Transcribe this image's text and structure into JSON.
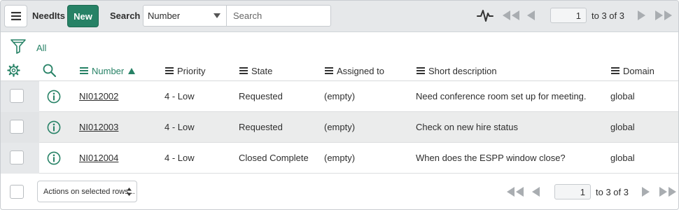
{
  "header": {
    "title": "NeedIts",
    "new_label": "New",
    "search_label": "Search",
    "search_field_selected": "Number",
    "search_placeholder": "Search",
    "page_value": "1",
    "range_text": "to 3 of 3"
  },
  "filter": {
    "breadcrumb": "All"
  },
  "columns": {
    "number": "Number",
    "priority": "Priority",
    "state": "State",
    "assigned_to": "Assigned to",
    "short_description": "Short description",
    "domain": "Domain",
    "sort_column": "number",
    "sort_direction": "ascending"
  },
  "rows": [
    {
      "number": "NI012002",
      "priority": "4 - Low",
      "state": "Requested",
      "assigned_to": "(empty)",
      "short_description": "Need conference room set up for meeting.",
      "domain": "global"
    },
    {
      "number": "NI012003",
      "priority": "4 - Low",
      "state": "Requested",
      "assigned_to": "(empty)",
      "short_description": "Check on new hire status",
      "domain": "global"
    },
    {
      "number": "NI012004",
      "priority": "4 - Low",
      "state": "Closed Complete",
      "assigned_to": "(empty)",
      "short_description": "When does the ESPP window close?",
      "domain": "global"
    }
  ],
  "footer": {
    "actions_label": "Actions on selected rows...",
    "page_value": "1",
    "range_text": "to 3 of 3"
  },
  "icons": {
    "menu": "hamburger-icon",
    "activity": "activity-stream-icon",
    "first": "first-page-icon",
    "prev": "previous-page-icon",
    "next": "next-page-icon",
    "last": "last-page-icon",
    "filter": "funnel-icon",
    "personalize": "gear-icon",
    "column_search": "search-icon",
    "column_menu": "hamburger-icon",
    "sort": "sort-up-icon",
    "preview": "info-circle-icon",
    "select_updown": "updown-icon"
  },
  "colors": {
    "accent": "#278266",
    "header_bg": "#e6e8ea",
    "alt_row_bg": "#ebecec",
    "pager_icon": "#a9adb1"
  }
}
